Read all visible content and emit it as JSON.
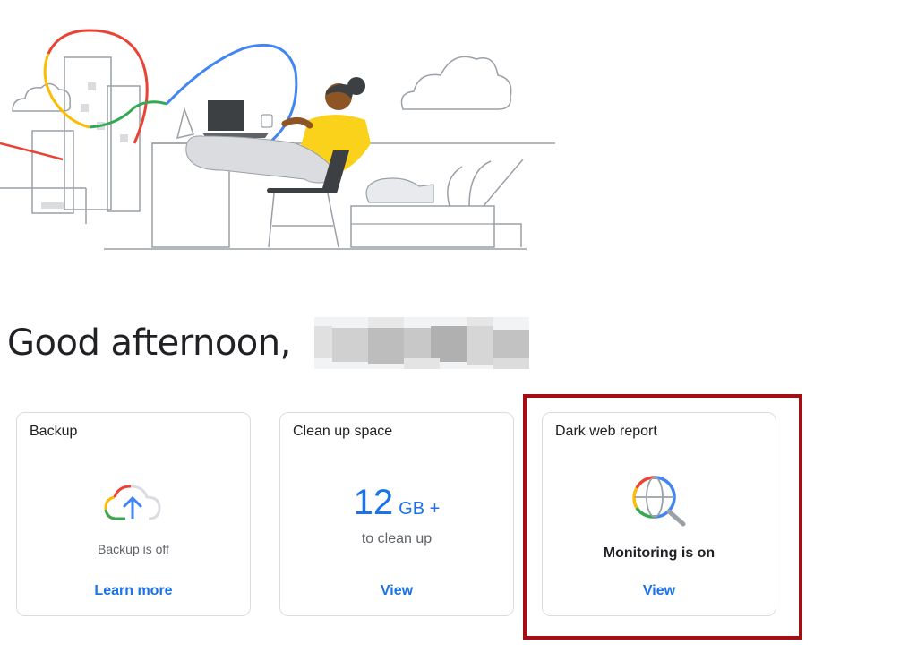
{
  "greeting": {
    "text": "Good afternoon,"
  },
  "cards": {
    "backup": {
      "title": "Backup",
      "icon": "cloud-upload-icon",
      "status": "Backup is off",
      "link": "Learn more"
    },
    "cleanup": {
      "title": "Clean up space",
      "amount": "12",
      "unit": "GB +",
      "subtitle": "to clean up",
      "link": "View"
    },
    "darkweb": {
      "title": "Dark web report",
      "icon": "globe-search-icon",
      "status": "Monitoring is on",
      "link": "View"
    }
  },
  "colors": {
    "accent_blue": "#1a73e8",
    "highlight_red": "#a50e15",
    "google_red": "#ea4335",
    "google_yellow": "#fbbc04",
    "google_green": "#34a853",
    "google_blue": "#4285f4",
    "illustration_yellow": "#fbd21b"
  }
}
